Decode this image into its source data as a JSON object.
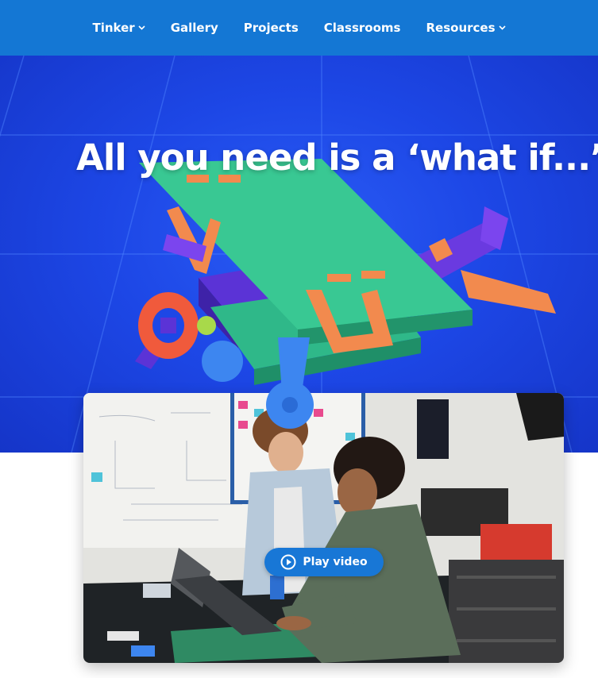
{
  "nav": {
    "items": [
      {
        "label": "Tinker",
        "has_dropdown": true
      },
      {
        "label": "Gallery",
        "has_dropdown": false
      },
      {
        "label": "Projects",
        "has_dropdown": false
      },
      {
        "label": "Classrooms",
        "has_dropdown": false
      },
      {
        "label": "Resources",
        "has_dropdown": true
      }
    ]
  },
  "hero": {
    "headline": "All you need is a ‘what if...’",
    "illustration_icon": "toy-biplane-icon"
  },
  "video": {
    "play_label": "Play video",
    "play_icon": "play-circle-icon"
  },
  "colors": {
    "nav_bg": "#1477d4",
    "hero_bg": "#1d47e6",
    "button_bg": "#1877d6",
    "text_light": "#ffffff"
  }
}
